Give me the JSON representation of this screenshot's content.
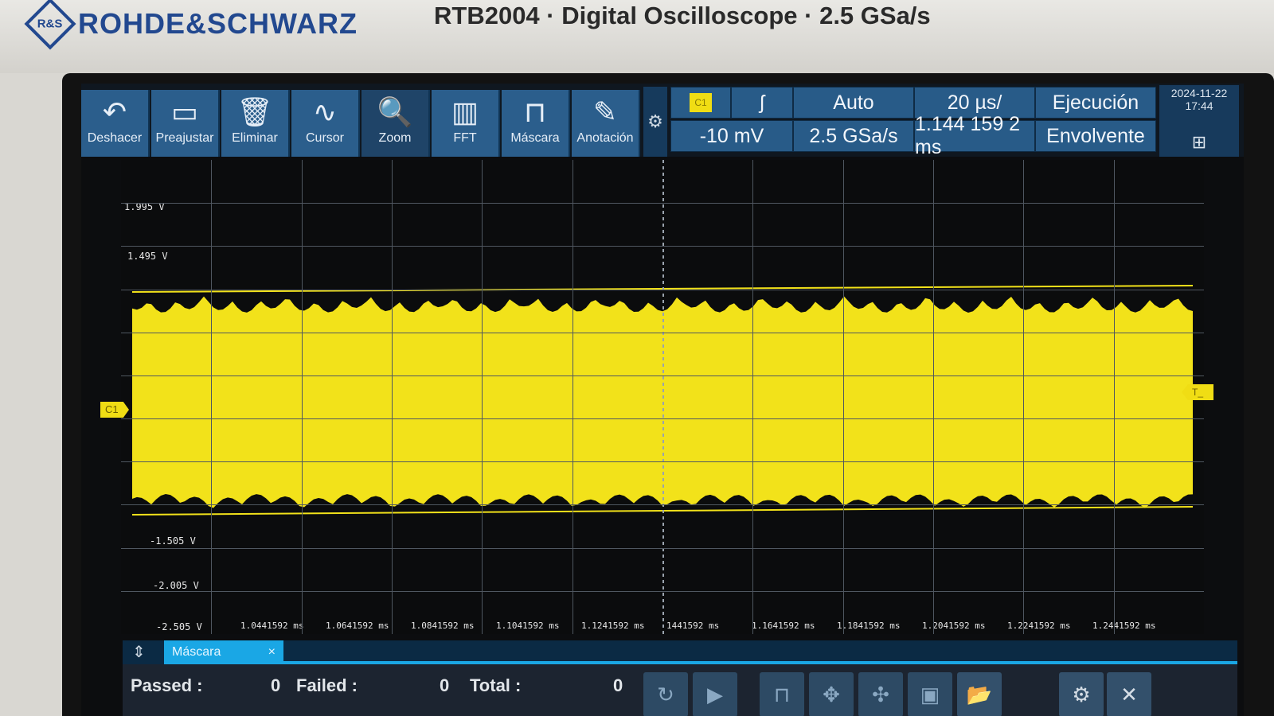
{
  "header": {
    "brand": "ROHDE&SCHWARZ",
    "brand_logo_text": "R&S",
    "model_line": "RTB2004 · Digital Oscilloscope · 2.5 GSa/s"
  },
  "toolbar": {
    "undo_label": "Deshacer",
    "preset_label": "Preajustar",
    "delete_label": "Eliminar",
    "cursor_label": "Cursor",
    "zoom_label": "Zoom",
    "fft_label": "FFT",
    "mask_label": "Máscara",
    "annotation_label": "Anotación"
  },
  "status": {
    "channel_badge": "C1",
    "edge_symbol": "ʃ",
    "trigger_mode": "Auto",
    "timebase": "20 µs/",
    "run_state": "Ejecución",
    "trigger_level": "-10 mV",
    "sample_rate": "2.5 GSa/s",
    "position": "1.144 159 2 ms",
    "acq_mode": "Envolvente",
    "date": "2024-11-22",
    "time": "17:44"
  },
  "plot": {
    "volt_labels": [
      "1.995 V",
      "1.495 V",
      "-1.505 V",
      "-2.005 V",
      "-2.505 V"
    ],
    "time_labels": [
      "1.0441592 ms",
      "1.0641592 ms",
      "1.0841592 ms",
      "1.1041592 ms",
      "1.1241592 ms",
      "1441592 ms",
      "1.1641592 ms",
      "1.1841592 ms",
      "1.2041592 ms",
      "1.2241592 ms",
      "1.2441592 ms"
    ],
    "channel_marker": "C1",
    "trigger_marker": "T_",
    "trace_color": "#f2e21a",
    "grid_color": "#4f5760"
  },
  "mask": {
    "tab_label": "Máscara",
    "tab_close": "×",
    "passed_label": "Passed :",
    "passed_value": "0",
    "failed_label": "Failed :",
    "failed_value": "0",
    "total_label": "Total :",
    "total_value": "0"
  }
}
